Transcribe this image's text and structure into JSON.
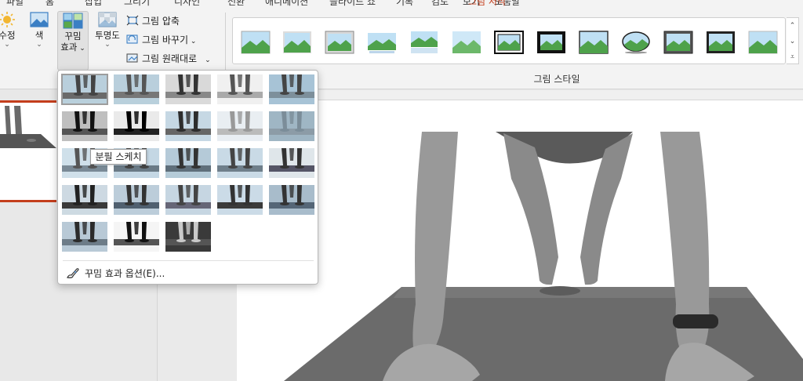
{
  "tabs": [
    "파일",
    "홈",
    "삽입",
    "그리기",
    "디자인",
    "전환",
    "애니메이션",
    "슬라이드 쇼",
    "기록",
    "검토",
    "보기",
    "도움말",
    "그림 서식"
  ],
  "active_tab": "그림 서식",
  "ribbon": {
    "corrections": {
      "label": "수정"
    },
    "color": {
      "label": "색"
    },
    "artistic_effects": {
      "label_line1": "꾸밈",
      "label_line2": "효과"
    },
    "transparency": {
      "label": "투명도"
    },
    "compress": {
      "label": "그림 압축"
    },
    "change_picture": {
      "label": "그림 바꾸기"
    },
    "reset_picture": {
      "label": "그림 원래대로"
    },
    "styles_group_label": "그림 스타일"
  },
  "artistic_effects_menu": {
    "tooltip": "분필 스케치",
    "options_label": "꾸밈 효과 옵션(E)...",
    "effect_count": 23
  },
  "colors": {
    "accent": "#c43e1c",
    "ribbon_bg": "#f3f3f3",
    "mat": "#6b6b6b"
  }
}
